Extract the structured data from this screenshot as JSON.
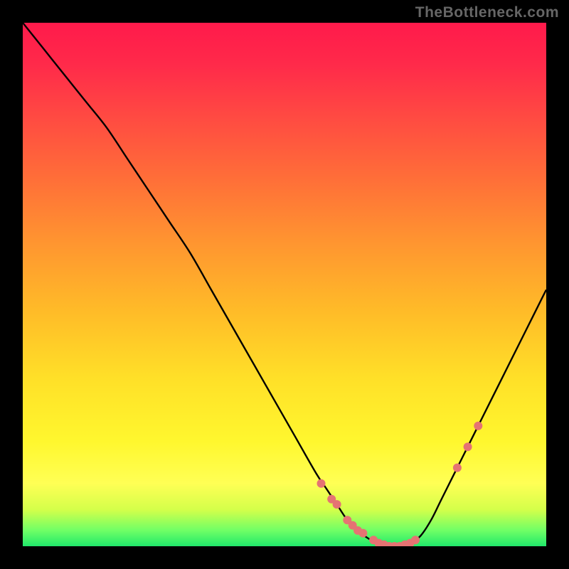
{
  "watermark": "TheBottleneck.com",
  "chart_data": {
    "type": "line",
    "title": "",
    "xlabel": "",
    "ylabel": "",
    "xlim": [
      0,
      100
    ],
    "ylim": [
      0,
      100
    ],
    "grid": false,
    "curve": {
      "name": "bottleneck-curve",
      "color": "#000000",
      "x": [
        0,
        4,
        8,
        12,
        16,
        20,
        24,
        28,
        32,
        36,
        40,
        44,
        48,
        52,
        56,
        58,
        60,
        62,
        64,
        66,
        68,
        70,
        72,
        74,
        76,
        78,
        80,
        84,
        88,
        92,
        96,
        100
      ],
      "y": [
        100,
        95,
        90,
        85,
        80,
        74,
        68,
        62,
        56,
        49,
        42,
        35,
        28,
        21,
        14,
        11,
        8,
        5,
        3,
        1.5,
        0.5,
        0,
        0,
        0.5,
        2,
        5,
        9,
        17,
        25,
        33,
        41,
        49
      ]
    },
    "marker_points": {
      "name": "curve-markers",
      "color": "#e57373",
      "radius": 6,
      "x": [
        57,
        59,
        60,
        62,
        63,
        64,
        65,
        67,
        68,
        69,
        70,
        71,
        72,
        73,
        74,
        75,
        83,
        85,
        87
      ],
      "y": [
        12,
        9,
        8,
        5,
        4,
        3,
        2.5,
        1.2,
        0.6,
        0.3,
        0,
        0,
        0,
        0.3,
        0.6,
        1.2,
        15,
        19,
        23
      ]
    },
    "gradient_bg": {
      "stops": [
        {
          "offset": 0.0,
          "color": "#ff1a4b"
        },
        {
          "offset": 0.08,
          "color": "#ff2a4a"
        },
        {
          "offset": 0.18,
          "color": "#ff4a42"
        },
        {
          "offset": 0.3,
          "color": "#ff6f38"
        },
        {
          "offset": 0.42,
          "color": "#ff9530"
        },
        {
          "offset": 0.55,
          "color": "#ffbb28"
        },
        {
          "offset": 0.68,
          "color": "#ffe028"
        },
        {
          "offset": 0.8,
          "color": "#fff72e"
        },
        {
          "offset": 0.88,
          "color": "#ffff55"
        },
        {
          "offset": 0.93,
          "color": "#d4ff4a"
        },
        {
          "offset": 0.97,
          "color": "#6fff66"
        },
        {
          "offset": 1.0,
          "color": "#20e86a"
        }
      ]
    }
  }
}
